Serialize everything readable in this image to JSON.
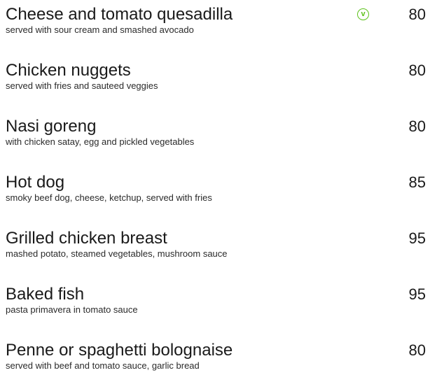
{
  "menu": {
    "items": [
      {
        "name": "Cheese and tomato quesadilla",
        "description": "served with sour cream and smashed avocado",
        "price": "80",
        "veg_badge": "v"
      },
      {
        "name": "Chicken nuggets",
        "description": "served with fries and sauteed veggies",
        "price": "80"
      },
      {
        "name": "Nasi goreng",
        "description": "with chicken satay, egg and pickled vegetables",
        "price": "80"
      },
      {
        "name": "Hot dog",
        "description": "smoky beef dog, cheese, ketchup, served with fries",
        "price": "85"
      },
      {
        "name": "Grilled chicken breast",
        "description": "mashed potato, steamed vegetables, mushroom sauce",
        "price": "95"
      },
      {
        "name": "Baked fish",
        "description": "pasta primavera in tomato sauce",
        "price": "95"
      },
      {
        "name": "Penne or spaghetti bolognaise",
        "description": "served with beef and tomato sauce, garlic bread",
        "price": "80"
      }
    ]
  },
  "icons": {
    "vegetarian": "vegetarian-icon"
  },
  "colors": {
    "text": "#1a1a1a",
    "vegetarian_badge": "#5cc21a",
    "background": "#ffffff"
  }
}
